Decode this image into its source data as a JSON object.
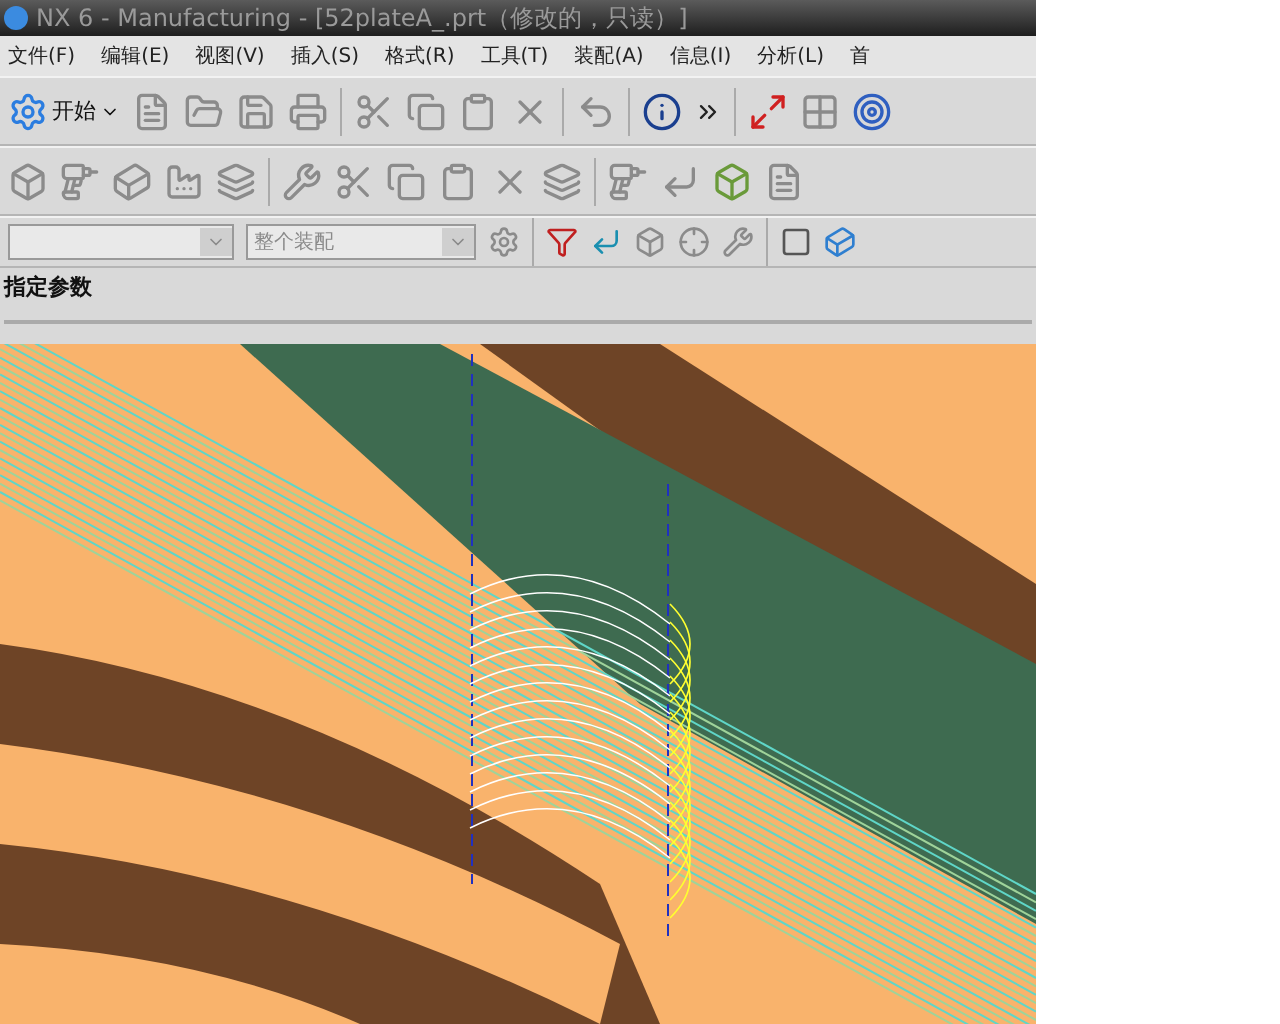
{
  "window": {
    "title": "NX 6 - Manufacturing - [52plateA_.prt（修改的，只读）]"
  },
  "menu": [
    "文件(F)",
    "编辑(E)",
    "视图(V)",
    "插入(S)",
    "格式(R)",
    "工具(T)",
    "装配(A)",
    "信息(I)",
    "分析(L)",
    "首"
  ],
  "toolbar": {
    "start_label": "开始"
  },
  "selection_bar": {
    "scope_value": "整个装配"
  },
  "cue_line": "指定参数"
}
